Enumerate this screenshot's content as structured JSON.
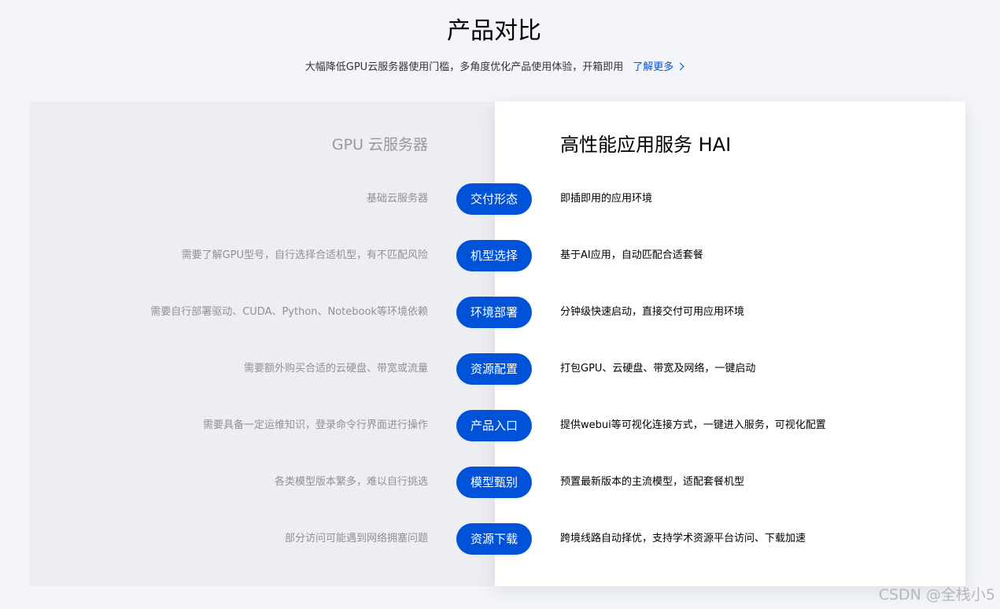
{
  "header": {
    "title": "产品对比",
    "subtitle": "大幅降低GPU云服务器使用门槛，多角度优化产品使用体验，开箱即用",
    "learn_more": "了解更多",
    "learn_more_icon": "chevron-right-icon"
  },
  "colors": {
    "accent": "#0052d9",
    "left_panel_bg": "#edeef2",
    "right_panel_bg": "#ffffff",
    "page_bg": "#f3f5f8"
  },
  "comparison": {
    "left_title": "GPU 云服务器",
    "right_title": "高性能应用服务 HAI",
    "rows": [
      {
        "label": "交付形态",
        "left": "基础云服务器",
        "right": "即插即用的应用环境"
      },
      {
        "label": "机型选择",
        "left": "需要了解GPU型号，自行选择合适机型，有不匹配风险",
        "right": "基于AI应用，自动匹配合适套餐"
      },
      {
        "label": "环境部署",
        "left": "需要自行部署驱动、CUDA、Python、Notebook等环境依赖",
        "right": "分钟级快速启动，直接交付可用应用环境"
      },
      {
        "label": "资源配置",
        "left": "需要额外购买合适的云硬盘、带宽或流量",
        "right": "打包GPU、云硬盘、带宽及网络，一键启动"
      },
      {
        "label": "产品入口",
        "left": "需要具备一定运维知识，登录命令行界面进行操作",
        "right": "提供webui等可视化连接方式，一键进入服务，可视化配置"
      },
      {
        "label": "模型甄别",
        "left": "各类模型版本繁多，难以自行挑选",
        "right": "预置最新版本的主流模型，适配套餐机型"
      },
      {
        "label": "资源下载",
        "left": "部分访问可能遇到网络拥塞问题",
        "right": "跨境线路自动择优，支持学术资源平台访问、下载加速"
      }
    ]
  },
  "watermark": "CSDN @全栈小5"
}
